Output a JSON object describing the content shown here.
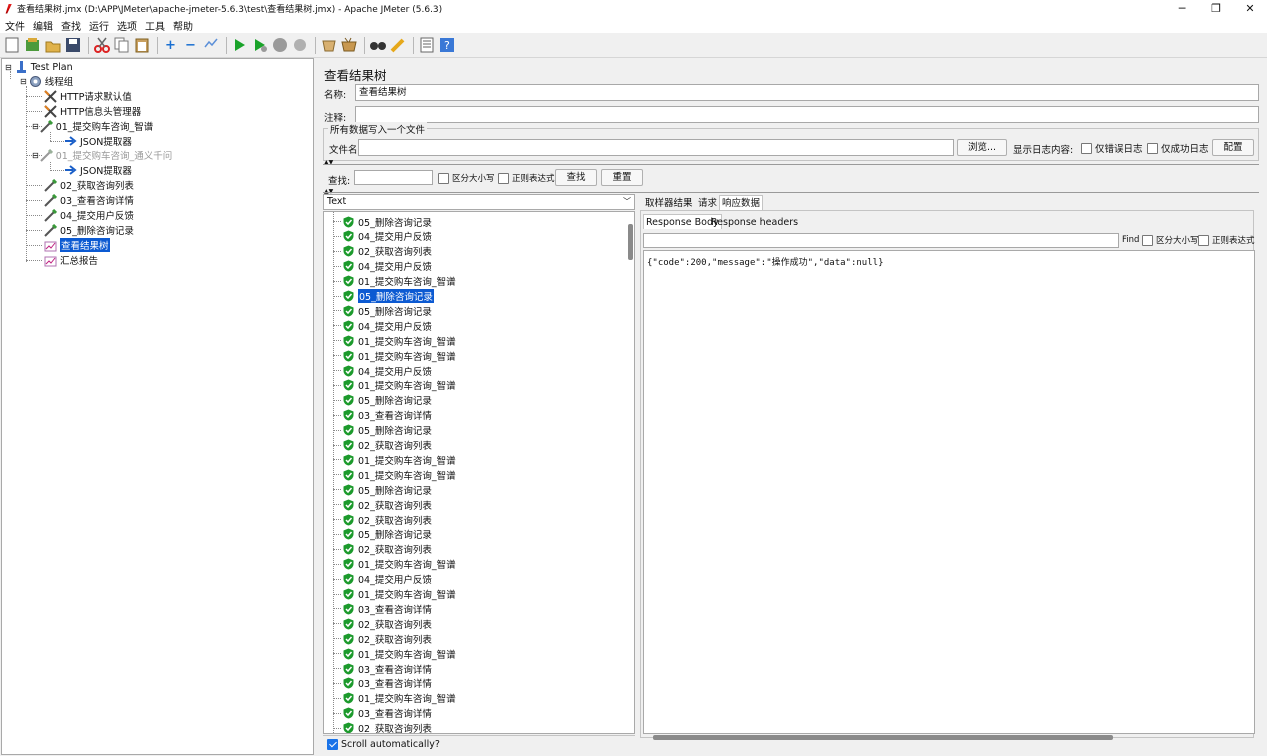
{
  "window": {
    "title": "查看结果树.jmx (D:\\APP\\JMeter\\apache-jmeter-5.6.3\\test\\查看结果树.jmx) - Apache JMeter (5.6.3)",
    "minimize": "─",
    "restore": "❐",
    "close": "✕"
  },
  "menu": [
    "文件",
    "编辑",
    "查找",
    "运行",
    "选项",
    "工具",
    "帮助"
  ],
  "tree": {
    "test_plan": "Test Plan",
    "thread_group": "线程组",
    "http_defaults": "HTTP请求默认值",
    "header_manager": "HTTP信息头管理器",
    "req1": "01_提交购车咨询_智谱",
    "json1": "JSON提取器",
    "req1_disabled": "01_提交购车咨询_通义千问",
    "json2": "JSON提取器",
    "req2": "02_获取咨询列表",
    "req3": "03_查看咨询详情",
    "req4": "04_提交用户反馈",
    "req5": "05_删除咨询记录",
    "result_tree": "查看结果树",
    "summary": "汇总报告"
  },
  "panel": {
    "title": "查看结果树",
    "name_label": "名称:",
    "name_value": "查看结果树",
    "comment_label": "注释:",
    "comment_value": "",
    "group_legend": "所有数据写入一个文件",
    "file_label": "文件名",
    "file_value": "",
    "browse": "浏览...",
    "log_label": "显示日志内容:",
    "errors_only": "仅错误日志",
    "success_only": "仅成功日志",
    "config": "配置",
    "search_label": "查找:",
    "search_value": "",
    "case_sensitive": "区分大小写",
    "regex": "正则表达式",
    "find": "查找",
    "reset": "重置",
    "renderer": "Text",
    "scroll_auto": "Scroll automatically?"
  },
  "results": [
    "05_删除咨询记录",
    "04_提交用户反馈",
    "02_获取咨询列表",
    "04_提交用户反馈",
    "01_提交购车咨询_智谱",
    "05_删除咨询记录",
    "05_删除咨询记录",
    "04_提交用户反馈",
    "01_提交购车咨询_智谱",
    "01_提交购车咨询_智谱",
    "04_提交用户反馈",
    "01_提交购车咨询_智谱",
    "05_删除咨询记录",
    "03_查看咨询详情",
    "05_删除咨询记录",
    "02_获取咨询列表",
    "01_提交购车咨询_智谱",
    "01_提交购车咨询_智谱",
    "05_删除咨询记录",
    "02_获取咨询列表",
    "02_获取咨询列表",
    "05_删除咨询记录",
    "02_获取咨询列表",
    "01_提交购车咨询_智谱",
    "04_提交用户反馈",
    "01_提交购车咨询_智谱",
    "03_查看咨询详情",
    "02_获取咨询列表",
    "02_获取咨询列表",
    "01_提交购车咨询_智谱",
    "03_查看咨询详情",
    "03_查看咨询详情",
    "01_提交购车咨询_智谱",
    "03_查看咨询详情",
    "02_获取咨询列表"
  ],
  "selected_result_index": 5,
  "response": {
    "tabs": [
      "取样器结果",
      "请求",
      "响应数据"
    ],
    "subtabs": [
      "Response Body",
      "Response headers"
    ],
    "find_label": "Find",
    "case_sensitive": "区分大小写",
    "regex": "正则表达式",
    "body": "{\"code\":200,\"message\":\"操作成功\",\"data\":null}"
  },
  "colors": {
    "selection": "#0c5ad2",
    "success_shield": "#1c9a2c",
    "accent": "#1a73e8"
  }
}
